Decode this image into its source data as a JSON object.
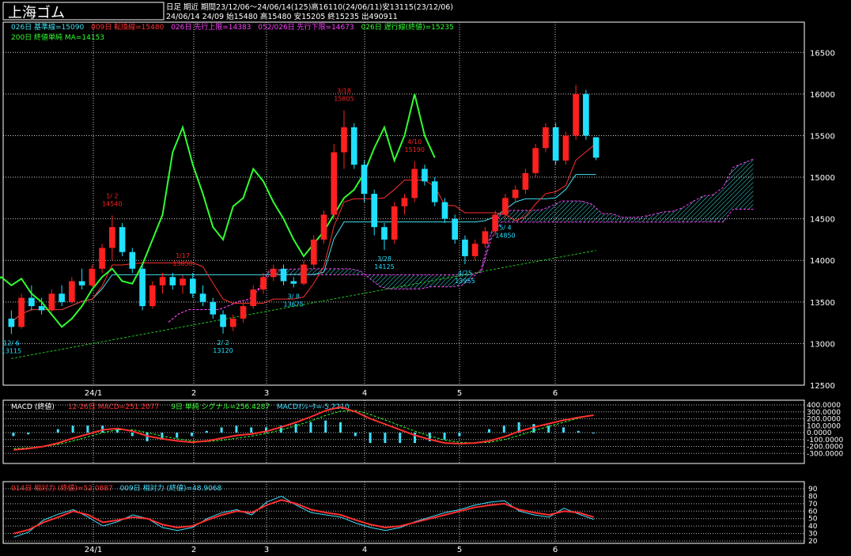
{
  "header": {
    "title": "上海ゴム",
    "period_line": "日足 期近 期間23/12/06〜24/06/14(125)高16110(24/06/11)安13115(23/12/06)",
    "quote_line": "24/06/14 24/09 始15480 高15480 安15205 終15235 出490911"
  },
  "legend": {
    "kijun": "026日 基準線=15090",
    "tenkan": "009日 転換線=15480",
    "senkou_a": "026日 先行上限=14383",
    "senkou_b": "052/026日 先行下限=14673",
    "chikou": "026日 遅行線(終値)=15235",
    "ma": "200日 終値単純 MA=14153"
  },
  "macd_legend": {
    "label": "MACD (終値)",
    "macd": "12-26日 MACD=251.2077",
    "signal": "9日 単純 シグナル=256.4287",
    "osc": "MACDｵｼﾚｰﾀ=-5.2210"
  },
  "rsi_legend": {
    "rsi14": "014日 相対力 (終値)=52.0887",
    "rsi9": "009日 相対力 (終値)=48.9068"
  },
  "annotations": [
    {
      "date": "12/ 6",
      "value": "13115",
      "kind": "low"
    },
    {
      "date": "1/ 2",
      "value": "14540",
      "kind": "high"
    },
    {
      "date": "1/17",
      "value": "13850",
      "kind": "high"
    },
    {
      "date": "2/ 2",
      "value": "13120",
      "kind": "low"
    },
    {
      "date": "3/ 8",
      "value": "13675",
      "kind": "low"
    },
    {
      "date": "3/18",
      "value": "15805",
      "kind": "high"
    },
    {
      "date": "3/28",
      "value": "14125",
      "kind": "low"
    },
    {
      "date": "4/10",
      "value": "15190",
      "kind": "high"
    },
    {
      "date": "4/25",
      "value": "13955",
      "kind": "low"
    },
    {
      "date": "5/ 4",
      "value": "14850",
      "kind": "low"
    }
  ],
  "colors": {
    "up": "#ff2020",
    "down": "#20e0ff",
    "kijun": "#40e0f0",
    "tenkan": "#ff3030",
    "chikou": "#30ff30",
    "cloud": "#ff40ff",
    "cloud_hatch": "#40ffff",
    "ma": "#20c020",
    "macd": "#ff3030",
    "signal": "#30ff30",
    "osc": "#40e0ff",
    "rsi14": "#ff3030",
    "rsi9": "#40e0ff",
    "grid": "#ffffff",
    "text": "#ffffff"
  },
  "chart_data": [
    {
      "type": "candlestick",
      "title": "上海ゴム",
      "ylim": [
        12500,
        16750
      ],
      "yticks": [
        12500,
        13000,
        13500,
        14000,
        14500,
        15000,
        15500,
        16000,
        16500
      ],
      "xticks": [
        "24/1",
        "2",
        "3",
        "4",
        "5",
        "6"
      ],
      "candles": [
        {
          "o": 13300,
          "h": 13400,
          "l": 13115,
          "c": 13200
        },
        {
          "o": 13200,
          "h": 13600,
          "l": 13180,
          "c": 13550
        },
        {
          "o": 13550,
          "h": 13700,
          "l": 13400,
          "c": 13450
        },
        {
          "o": 13450,
          "h": 13550,
          "l": 13350,
          "c": 13400
        },
        {
          "o": 13400,
          "h": 13650,
          "l": 13380,
          "c": 13600
        },
        {
          "o": 13600,
          "h": 13700,
          "l": 13450,
          "c": 13500
        },
        {
          "o": 13500,
          "h": 13800,
          "l": 13480,
          "c": 13750
        },
        {
          "o": 13750,
          "h": 13900,
          "l": 13650,
          "c": 13700
        },
        {
          "o": 13700,
          "h": 13950,
          "l": 13680,
          "c": 13900
        },
        {
          "o": 13900,
          "h": 14200,
          "l": 13850,
          "c": 14150
        },
        {
          "o": 14150,
          "h": 14540,
          "l": 14000,
          "c": 14400
        },
        {
          "o": 14400,
          "h": 14450,
          "l": 14050,
          "c": 14100
        },
        {
          "o": 14100,
          "h": 14150,
          "l": 13850,
          "c": 13900
        },
        {
          "o": 13900,
          "h": 13950,
          "l": 13400,
          "c": 13450
        },
        {
          "o": 13450,
          "h": 13750,
          "l": 13420,
          "c": 13700
        },
        {
          "o": 13700,
          "h": 13850,
          "l": 13600,
          "c": 13800
        },
        {
          "o": 13800,
          "h": 13850,
          "l": 13650,
          "c": 13700
        },
        {
          "o": 13700,
          "h": 13820,
          "l": 13600,
          "c": 13780
        },
        {
          "o": 13780,
          "h": 13850,
          "l": 13550,
          "c": 13600
        },
        {
          "o": 13600,
          "h": 13700,
          "l": 13450,
          "c": 13500
        },
        {
          "o": 13500,
          "h": 13550,
          "l": 13300,
          "c": 13350
        },
        {
          "o": 13350,
          "h": 13400,
          "l": 13120,
          "c": 13200
        },
        {
          "o": 13200,
          "h": 13350,
          "l": 13150,
          "c": 13300
        },
        {
          "o": 13300,
          "h": 13500,
          "l": 13250,
          "c": 13450
        },
        {
          "o": 13450,
          "h": 13700,
          "l": 13420,
          "c": 13650
        },
        {
          "o": 13650,
          "h": 13850,
          "l": 13600,
          "c": 13800
        },
        {
          "o": 13800,
          "h": 13950,
          "l": 13750,
          "c": 13900
        },
        {
          "o": 13900,
          "h": 13950,
          "l": 13700,
          "c": 13750
        },
        {
          "o": 13750,
          "h": 13800,
          "l": 13675,
          "c": 13720
        },
        {
          "o": 13720,
          "h": 14000,
          "l": 13700,
          "c": 13950
        },
        {
          "o": 13950,
          "h": 14300,
          "l": 13900,
          "c": 14250
        },
        {
          "o": 14250,
          "h": 14600,
          "l": 14200,
          "c": 14550
        },
        {
          "o": 14550,
          "h": 15400,
          "l": 14500,
          "c": 15300
        },
        {
          "o": 15300,
          "h": 15805,
          "l": 15100,
          "c": 15600
        },
        {
          "o": 15600,
          "h": 15650,
          "l": 15100,
          "c": 15150
        },
        {
          "o": 15150,
          "h": 15200,
          "l": 14700,
          "c": 14800
        },
        {
          "o": 14800,
          "h": 14850,
          "l": 14300,
          "c": 14400
        },
        {
          "o": 14400,
          "h": 14450,
          "l": 14125,
          "c": 14250
        },
        {
          "o": 14250,
          "h": 14700,
          "l": 14200,
          "c": 14650
        },
        {
          "o": 14650,
          "h": 14800,
          "l": 14550,
          "c": 14750
        },
        {
          "o": 14750,
          "h": 15190,
          "l": 14700,
          "c": 15100
        },
        {
          "o": 15100,
          "h": 15150,
          "l": 14900,
          "c": 14950
        },
        {
          "o": 14950,
          "h": 15000,
          "l": 14650,
          "c": 14700
        },
        {
          "o": 14700,
          "h": 14750,
          "l": 14450,
          "c": 14500
        },
        {
          "o": 14500,
          "h": 14550,
          "l": 14200,
          "c": 14250
        },
        {
          "o": 14250,
          "h": 14300,
          "l": 13955,
          "c": 14050
        },
        {
          "o": 14050,
          "h": 14250,
          "l": 14000,
          "c": 14200
        },
        {
          "o": 14200,
          "h": 14400,
          "l": 14150,
          "c": 14350
        },
        {
          "o": 14350,
          "h": 14600,
          "l": 14300,
          "c": 14550
        },
        {
          "o": 14550,
          "h": 14800,
          "l": 14500,
          "c": 14750
        },
        {
          "o": 14750,
          "h": 14900,
          "l": 14700,
          "c": 14850
        },
        {
          "o": 14850,
          "h": 15100,
          "l": 14800,
          "c": 15050
        },
        {
          "o": 15050,
          "h": 15400,
          "l": 15000,
          "c": 15350
        },
        {
          "o": 15350,
          "h": 15650,
          "l": 15300,
          "c": 15600
        },
        {
          "o": 15600,
          "h": 15650,
          "l": 15150,
          "c": 15200
        },
        {
          "o": 15200,
          "h": 15550,
          "l": 15150,
          "c": 15500
        },
        {
          "o": 15500,
          "h": 16110,
          "l": 15450,
          "c": 16000
        },
        {
          "o": 16000,
          "h": 16050,
          "l": 15450,
          "c": 15500
        },
        {
          "o": 15480,
          "h": 15480,
          "l": 15205,
          "c": 15235
        }
      ]
    },
    {
      "type": "line",
      "title": "MACD (終値)",
      "ylim": [
        -400,
        400
      ],
      "yticks": [
        "400.0000",
        "300.0000",
        "200.0000",
        "100.0000",
        "0.0000",
        "-100.0000",
        "-200.0000",
        "-300.0000"
      ],
      "series": [
        {
          "name": "MACD",
          "values": [
            -250,
            -230,
            -200,
            -150,
            -80,
            -20,
            40,
            60,
            20,
            -50,
            -90,
            -120,
            -140,
            -120,
            -80,
            -40,
            -20,
            20,
            80,
            150,
            230,
            320,
            370,
            300,
            200,
            120,
            40,
            -40,
            -100,
            -150,
            -160,
            -150,
            -120,
            -60,
            20,
            80,
            130,
            180,
            220,
            251
          ]
        },
        {
          "name": "シグナル",
          "values": [
            -230,
            -220,
            -200,
            -170,
            -120,
            -60,
            0,
            40,
            40,
            0,
            -50,
            -90,
            -120,
            -130,
            -110,
            -80,
            -50,
            -10,
            40,
            100,
            170,
            250,
            310,
            320,
            260,
            180,
            100,
            20,
            -50,
            -110,
            -140,
            -150,
            -140,
            -100,
            -40,
            30,
            90,
            150,
            210,
            256
          ]
        }
      ]
    },
    {
      "type": "line",
      "title": "相対力",
      "ylim": [
        20,
        90
      ],
      "yticks": [
        "90",
        "80",
        "70",
        "60",
        "50",
        "40",
        "30",
        "20"
      ],
      "series": [
        {
          "name": "014日 相対力",
          "values": [
            30,
            35,
            45,
            52,
            60,
            55,
            45,
            48,
            52,
            50,
            42,
            38,
            40,
            48,
            55,
            60,
            58,
            68,
            75,
            70,
            62,
            58,
            55,
            48,
            42,
            38,
            40,
            45,
            50,
            55,
            60,
            65,
            68,
            70,
            62,
            58,
            55,
            60,
            58,
            52
          ]
        },
        {
          "name": "009日 相対力",
          "values": [
            25,
            32,
            48,
            56,
            62,
            52,
            40,
            46,
            55,
            50,
            38,
            34,
            38,
            50,
            58,
            62,
            55,
            72,
            80,
            68,
            58,
            55,
            52,
            44,
            38,
            34,
            38,
            46,
            52,
            58,
            62,
            68,
            72,
            74,
            60,
            55,
            52,
            64,
            56,
            49
          ]
        }
      ]
    }
  ]
}
